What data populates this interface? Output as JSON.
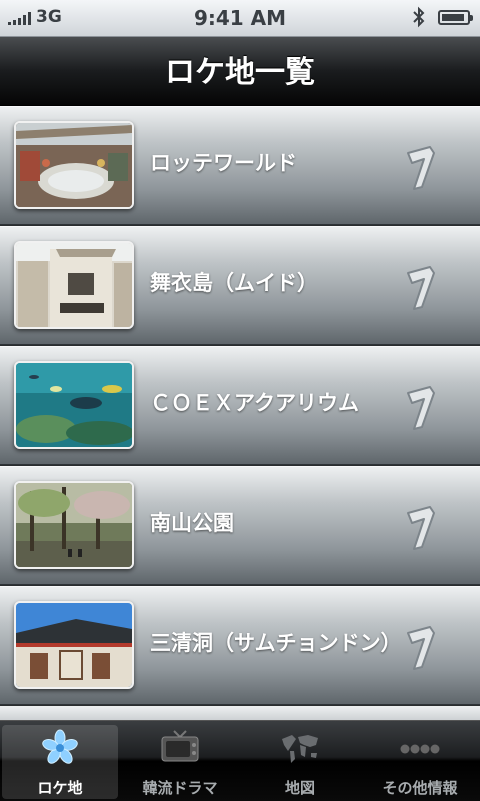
{
  "status_bar": {
    "carrier": "3G",
    "time": "9:41 AM",
    "battery_level": 0.9
  },
  "header": {
    "title": "ロケ地一覧"
  },
  "locations": [
    {
      "name": "ロッテワールド",
      "thumbnail": "lotte-world-photo"
    },
    {
      "name": "舞衣島（ムイド）",
      "thumbnail": "muido-house-photo"
    },
    {
      "name": "ＣＯＥＸアクアリウム",
      "thumbnail": "aquarium-photo"
    },
    {
      "name": "南山公園",
      "thumbnail": "namsan-park-photo"
    },
    {
      "name": "三清洞（サムチョンドン）",
      "thumbnail": "samcheong-dong-photo"
    }
  ],
  "tabs": [
    {
      "label": "ロケ地",
      "icon": "flower-icon",
      "active": true
    },
    {
      "label": "韓流ドラマ",
      "icon": "tv-icon",
      "active": false
    },
    {
      "label": "地図",
      "icon": "world-map-icon",
      "active": false
    },
    {
      "label": "その他情報",
      "icon": "more-dots-icon",
      "active": false
    }
  ],
  "colors": {
    "header_bg": "#0b0b0b",
    "row_top": "#eef0f1",
    "row_bottom": "#5f666b",
    "tab_active": "#ffffff",
    "tab_inactive": "#a8acaf"
  }
}
